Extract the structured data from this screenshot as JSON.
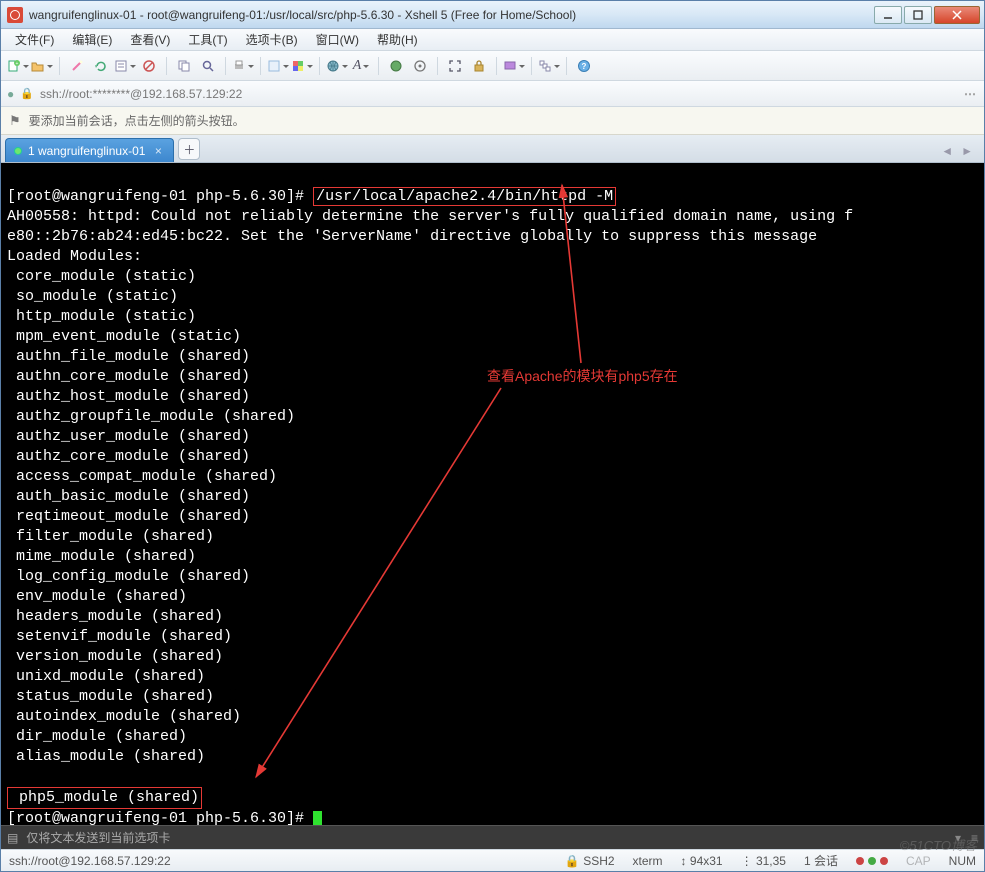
{
  "titlebar": {
    "text": "wangruifenglinux-01 - root@wangruifeng-01:/usr/local/src/php-5.6.30 - Xshell 5 (Free for Home/School)"
  },
  "menubar": {
    "items": [
      "文件(F)",
      "编辑(E)",
      "查看(V)",
      "工具(T)",
      "选项卡(B)",
      "窗口(W)",
      "帮助(H)"
    ]
  },
  "icons": {
    "new": "new-file-icon",
    "open": "open-folder-icon",
    "wand": "wand-icon",
    "reconnect": "reconnect-icon",
    "props": "properties-icon",
    "disconnect": "disconnect-icon",
    "copy": "copy-icon",
    "paste": "paste-icon",
    "find": "find-icon",
    "print": "print-icon",
    "font": "font-icon",
    "color": "color-scheme-icon",
    "globe": "globe-icon",
    "fontsize": "font-size-icon",
    "encoding": "encoding-icon",
    "xftp": "xftp-icon",
    "manager": "manager-icon",
    "fullscreen": "fullscreen-icon",
    "lock": "lock-icon",
    "record": "record-icon",
    "cascade": "cascade-tile-icon",
    "help": "help-icon"
  },
  "addressbar": {
    "protocol_label": "ssh://root:********@192.168.57.129:22"
  },
  "infobar": {
    "text": "要添加当前会话，点击左侧的箭头按钮。"
  },
  "tabs": {
    "items": [
      {
        "label": "1 wangruifenglinux-01",
        "active": true
      }
    ]
  },
  "terminal": {
    "prompt1": "[root@wangruifeng-01 php-5.6.30]# ",
    "command": "/usr/local/apache2.4/bin/httpd -M",
    "warn1": "AH00558: httpd: Could not reliably determine the server's fully qualified domain name, using f",
    "warn2": "e80::2b76:ab24:ed45:bc22. Set the 'ServerName' directive globally to suppress this message",
    "loaded": "Loaded Modules:",
    "modules": [
      " core_module (static)",
      " so_module (static)",
      " http_module (static)",
      " mpm_event_module (static)",
      " authn_file_module (shared)",
      " authn_core_module (shared)",
      " authz_host_module (shared)",
      " authz_groupfile_module (shared)",
      " authz_user_module (shared)",
      " authz_core_module (shared)",
      " access_compat_module (shared)",
      " auth_basic_module (shared)",
      " reqtimeout_module (shared)",
      " filter_module (shared)",
      " mime_module (shared)",
      " log_config_module (shared)",
      " env_module (shared)",
      " headers_module (shared)",
      " setenvif_module (shared)",
      " version_module (shared)",
      " unixd_module (shared)",
      " status_module (shared)",
      " autoindex_module (shared)",
      " dir_module (shared)",
      " alias_module (shared)"
    ],
    "highlight_module": " php5_module (shared)",
    "prompt2": "[root@wangruifeng-01 php-5.6.30]# ",
    "annotation": "查看Apache的模块有php5存在"
  },
  "cmdbar": {
    "text": "仅将文本发送到当前选项卡"
  },
  "statusbar": {
    "left": "ssh://root@192.168.57.129:22",
    "ssh": "SSH2",
    "term": "xterm",
    "size": "94x31",
    "cursor": "31,35",
    "session": "1 会话",
    "cap": "CAP",
    "num": "NUM"
  },
  "watermark": "©51CTO博客"
}
